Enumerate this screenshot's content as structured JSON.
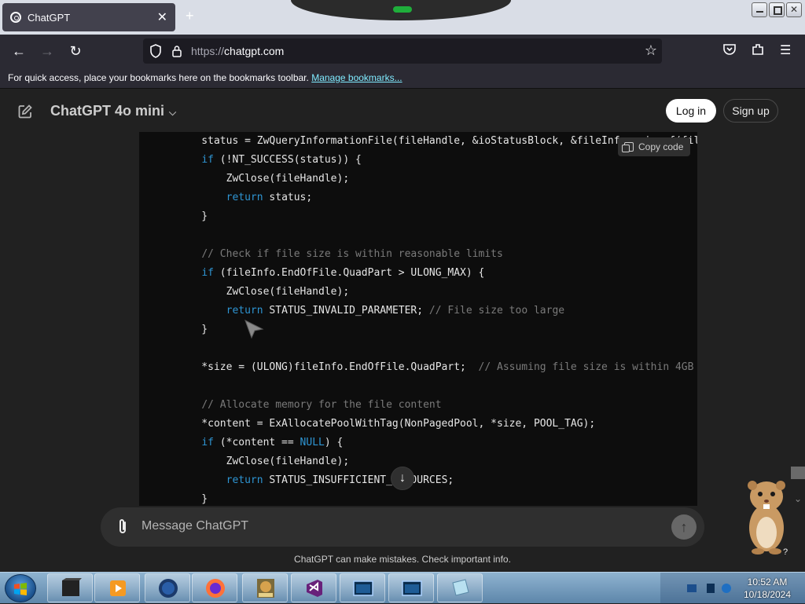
{
  "browser": {
    "tab_title": "ChatGPT",
    "url_scheme": "https://",
    "url_host": "chatgpt.com",
    "bookmarks_text": "For quick access, place your bookmarks here on the bookmarks toolbar.",
    "bookmarks_link": "Manage bookmarks..."
  },
  "header": {
    "model": "ChatGPT 4o mini",
    "login": "Log in",
    "signup": "Sign up"
  },
  "code": {
    "copy_label": "Copy code",
    "lines": [
      [
        {
          "t": "    status = ZwQueryInformationFile(fileHandle, &ioStatusBlock, &fileInfo, sizeof(fileInfo), FileStandardInformation);"
        }
      ],
      [
        {
          "t": "    "
        },
        {
          "t": "if",
          "c": "kw"
        },
        {
          "t": " (!NT_SUCCESS(status)) {"
        }
      ],
      [
        {
          "t": "        ZwClose(fileHandle);"
        }
      ],
      [
        {
          "t": "        "
        },
        {
          "t": "return",
          "c": "kw"
        },
        {
          "t": " status;"
        }
      ],
      [
        {
          "t": "    }"
        }
      ],
      [
        {
          "t": ""
        }
      ],
      [
        {
          "t": "    "
        },
        {
          "t": "// Check if file size is within reasonable limits",
          "c": "cm"
        }
      ],
      [
        {
          "t": "    "
        },
        {
          "t": "if",
          "c": "kw"
        },
        {
          "t": " (fileInfo.EndOfFile.QuadPart > ULONG_MAX) {"
        }
      ],
      [
        {
          "t": "        ZwClose(fileHandle);"
        }
      ],
      [
        {
          "t": "        "
        },
        {
          "t": "return",
          "c": "kw"
        },
        {
          "t": " STATUS_INVALID_PARAMETER; "
        },
        {
          "t": "// File size too large",
          "c": "cm"
        }
      ],
      [
        {
          "t": "    }"
        }
      ],
      [
        {
          "t": ""
        }
      ],
      [
        {
          "t": "    *size = (ULONG)fileInfo.EndOfFile.QuadPart;  "
        },
        {
          "t": "// Assuming file size is within 4GB",
          "c": "cm"
        }
      ],
      [
        {
          "t": ""
        }
      ],
      [
        {
          "t": "    "
        },
        {
          "t": "// Allocate memory for the file content",
          "c": "cm"
        }
      ],
      [
        {
          "t": "    *content = ExAllocatePoolWithTag(NonPagedPool, *size, POOL_TAG);"
        }
      ],
      [
        {
          "t": "    "
        },
        {
          "t": "if",
          "c": "kw"
        },
        {
          "t": " (*content == "
        },
        {
          "t": "NULL",
          "c": "kw"
        },
        {
          "t": ") {"
        }
      ],
      [
        {
          "t": "        ZwClose(fileHandle);"
        }
      ],
      [
        {
          "t": "        "
        },
        {
          "t": "return",
          "c": "kw"
        },
        {
          "t": " STATUS_INSUFFICIENT_RESOURCES;"
        }
      ],
      [
        {
          "t": "    }"
        }
      ]
    ]
  },
  "composer": {
    "placeholder": "Message ChatGPT",
    "disclaimer": "ChatGPT can make mistakes. Check important info."
  },
  "taskbar": {
    "time": "10:52 AM",
    "date": "10/18/2024",
    "apps": [
      "terminal-app",
      "media-player-app",
      "globe-app",
      "firefox-app",
      "game-box-app",
      "visual-studio-app",
      "window-app-1",
      "window-app-2",
      "notes-app"
    ]
  },
  "colors": {
    "code_bg": "#0d0d0d",
    "keyword": "#2e95d3",
    "comment": "#7a7a7a",
    "page_bg": "#212121",
    "composer_bg": "#2f2f2f"
  }
}
